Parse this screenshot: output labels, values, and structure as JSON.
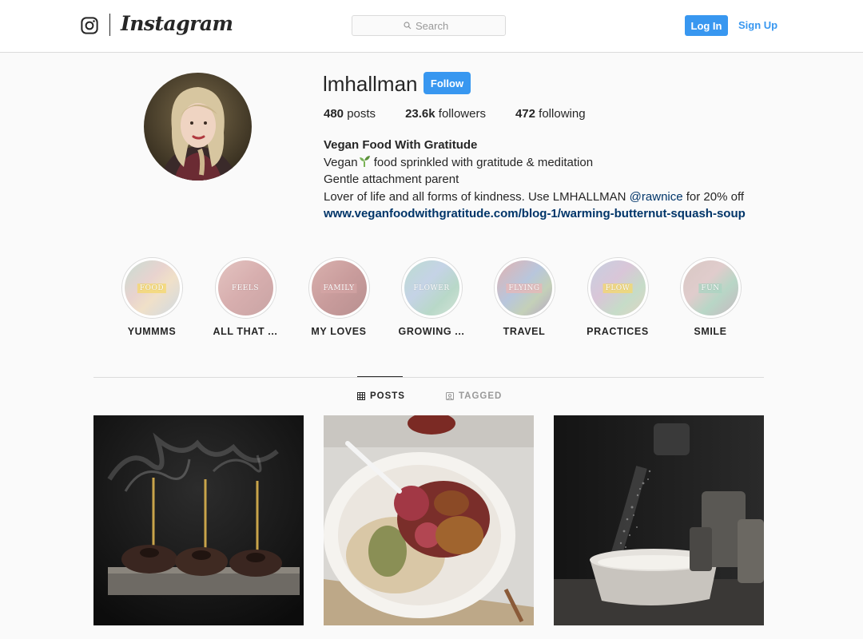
{
  "header": {
    "logo_icon": "instagram-camera-icon",
    "wordmark": "Instagram",
    "search_placeholder": "Search",
    "login_label": "Log In",
    "signup_label": "Sign Up"
  },
  "profile": {
    "username": "lmhallman",
    "follow_label": "Follow",
    "stats": {
      "posts_count": "480",
      "posts_label": "posts",
      "followers_count": "23.6k",
      "followers_label": "followers",
      "following_count": "472",
      "following_label": "following"
    },
    "full_name": "Vegan Food With Gratitude",
    "bio_line1_prefix": "Vegan",
    "bio_line1_emoji": "seedling-emoji",
    "bio_line1_suffix": " food sprinkled with gratitude & meditation",
    "bio_line2": "Gentle attachment parent",
    "bio_line3_prefix": "Lover of life and all forms of kindness. Use LMHALLMAN ",
    "bio_line3_mention": "@rawnice",
    "bio_line3_suffix": " for 20% off",
    "link": "www.veganfoodwithgratitude.com/blog-1/warming-butternut-squash-soup"
  },
  "highlights": [
    {
      "label": "YUMMMS",
      "cover_word": "FOOD",
      "accent": "#f5d86a"
    },
    {
      "label": "ALL THAT ...",
      "cover_word": "FEELS",
      "accent": "#e0b9b9"
    },
    {
      "label": "MY LOVES",
      "cover_word": "FAMILY",
      "accent": "#d7a7a7"
    },
    {
      "label": "GROWING ...",
      "cover_word": "FLOWER",
      "accent": "#bcdcd0"
    },
    {
      "label": "TRAVEL",
      "cover_word": "FLYING",
      "accent": "#e8b7b7"
    },
    {
      "label": "PRACTICES",
      "cover_word": "FLOW",
      "accent": "#f5d86a"
    },
    {
      "label": "SMILE",
      "cover_word": "FUN",
      "accent": "#a9d4c2"
    }
  ],
  "tabs": {
    "posts_label": "POSTS",
    "posts_icon": "grid-icon",
    "tagged_label": "TAGGED",
    "tagged_icon": "tag-icon"
  },
  "posts": [
    {
      "subject": "incense-sticks-on-chocolate-cakes"
    },
    {
      "subject": "oatmeal-bowl-with-blood-orange"
    },
    {
      "subject": "sifting-flour-into-bowl"
    }
  ],
  "colors": {
    "accent_blue": "#3897f0",
    "link_navy": "#003569",
    "text": "#262626",
    "muted": "#999999",
    "border": "#dbdbdb",
    "background": "#fafafa"
  }
}
